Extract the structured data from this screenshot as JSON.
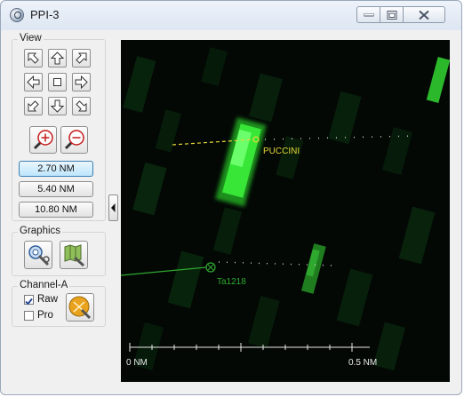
{
  "window": {
    "title": "PPI-3",
    "icon": "magnifier-icon"
  },
  "title_buttons": [
    {
      "name": "minimize-button",
      "icon": "minimize-icon"
    },
    {
      "name": "maximize-button",
      "icon": "maximize-icon"
    },
    {
      "name": "close-button",
      "icon": "close-icon"
    }
  ],
  "view": {
    "label": "View",
    "pan_buttons": [
      "arrow-up-left-icon",
      "arrow-up-icon",
      "arrow-up-right-icon",
      "arrow-left-icon",
      "center-icon",
      "arrow-right-icon",
      "arrow-down-left-icon",
      "arrow-down-icon",
      "arrow-down-right-icon"
    ],
    "zoom_in_icon": "zoom-in-icon",
    "zoom_out_icon": "zoom-out-icon",
    "ranges": [
      "2.70 NM",
      "5.40 NM",
      "10.80 NM"
    ],
    "selected_range": "2.70 NM"
  },
  "graphics": {
    "label": "Graphics",
    "buttons": [
      "graphics-settings-icon",
      "graphics-map-tools-icon"
    ]
  },
  "channel": {
    "label": "Channel-A",
    "raw_label": "Raw",
    "raw_checked": true,
    "pro_label": "Pro",
    "pro_checked": false,
    "settings_icon": "channel-settings-icon"
  },
  "radar": {
    "targets": [
      {
        "label": "PUCCINI",
        "color": "#e6d73a"
      },
      {
        "label": "Ta1218",
        "color": "#2fa82f"
      }
    ],
    "scale": {
      "start_label": "0 NM",
      "end_label": "0.5 NM"
    },
    "colors": {
      "background": "#030805",
      "echo": "#37e637",
      "scale": "#e8e8e8"
    }
  }
}
